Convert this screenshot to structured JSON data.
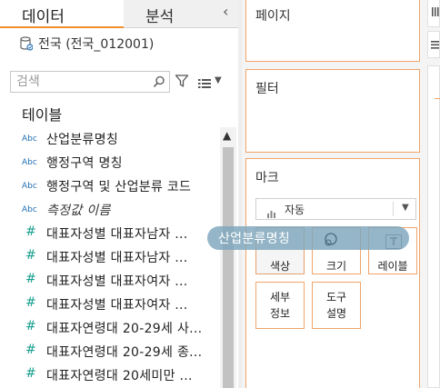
{
  "data_pane": {
    "tab_data": "데이터",
    "tab_analysis": "분석",
    "datasource": "전국 (전국_012001)",
    "search_placeholder": "검색",
    "tables_label": "테이블",
    "fields": [
      {
        "type_label": "Abc",
        "name": "산업분류명칭",
        "kind": "dimension"
      },
      {
        "type_label": "Abc",
        "name": "행정구역 명칭",
        "kind": "dimension"
      },
      {
        "type_label": "Abc",
        "name": "행정구역 및 산업분류 코드",
        "kind": "dimension"
      },
      {
        "type_label": "Abc",
        "name": "측정값 이름",
        "kind": "dimension-italic"
      },
      {
        "type_label": "#",
        "name": "대표자성별 대표자남자 ...",
        "kind": "measure"
      },
      {
        "type_label": "#",
        "name": "대표자성별 대표자남자 ...",
        "kind": "measure"
      },
      {
        "type_label": "#",
        "name": "대표자성별 대표자여자 ...",
        "kind": "measure"
      },
      {
        "type_label": "#",
        "name": "대표자성별 대표자여자 ...",
        "kind": "measure"
      },
      {
        "type_label": "#",
        "name": "대표자연령대 20-29세 사...",
        "kind": "measure"
      },
      {
        "type_label": "#",
        "name": "대표자연령대 20-29세 종...",
        "kind": "measure"
      },
      {
        "type_label": "#",
        "name": "대표자연령대 20세미만 ...",
        "kind": "measure"
      }
    ]
  },
  "cards": {
    "pages_title": "페이지",
    "filters_title": "필터",
    "marks_title": "마크",
    "mark_type": "자동",
    "buttons": {
      "color": "색상",
      "size": "크기",
      "label": "레이블",
      "detail": "세부\n정보",
      "tooltip": "도구\n설명"
    }
  },
  "drag_pill": {
    "label": "산업분류명칭"
  },
  "colors": {
    "accent_orange": "#f28e2c",
    "card_border": "#f0a46a",
    "dimension_blue": "#1f6fb5",
    "measure_teal": "#1aa08f",
    "pill": "#7ea6bc"
  },
  "icons": [
    "datasource-icon",
    "search-icon",
    "filter-icon",
    "list-view-icon",
    "scroll-up-icon",
    "bar-chart-icon",
    "text-label-icon",
    "size-ring-icon"
  ]
}
